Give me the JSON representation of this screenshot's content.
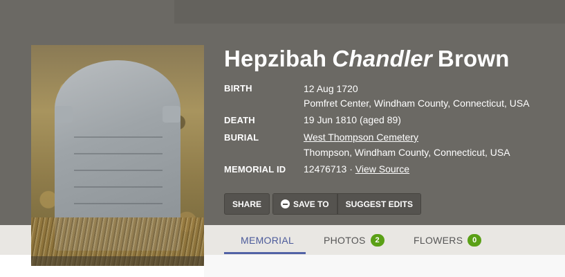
{
  "person": {
    "first": "Hepzibah",
    "maiden": "Chandler",
    "last": "Brown"
  },
  "facts": {
    "birth_label": "BIRTH",
    "birth_date": "12 Aug 1720",
    "birth_place": "Pomfret Center, Windham County, Connecticut, USA",
    "death_label": "DEATH",
    "death_date": "19 Jun 1810 (aged 89)",
    "burial_label": "BURIAL",
    "burial_cemetery": "West Thompson Cemetery",
    "burial_place": "Thompson, Windham County, Connecticut, USA",
    "memorial_label": "MEMORIAL ID",
    "memorial_id": "12476713",
    "separator": "·",
    "view_source": "View Source"
  },
  "actions": {
    "share": "SHARE",
    "save_to": "SAVE TO",
    "suggest_edits": "SUGGEST EDITS"
  },
  "tabs": [
    {
      "label": "MEMORIAL",
      "active": true
    },
    {
      "label": "PHOTOS",
      "count": "2"
    },
    {
      "label": "FLOWERS",
      "count": "0"
    }
  ],
  "colors": {
    "hero_bg": "#6b6964",
    "tab_active": "#4b5a9a",
    "badge": "#5aa016"
  },
  "icons": {
    "save": "minus-circle-icon"
  }
}
